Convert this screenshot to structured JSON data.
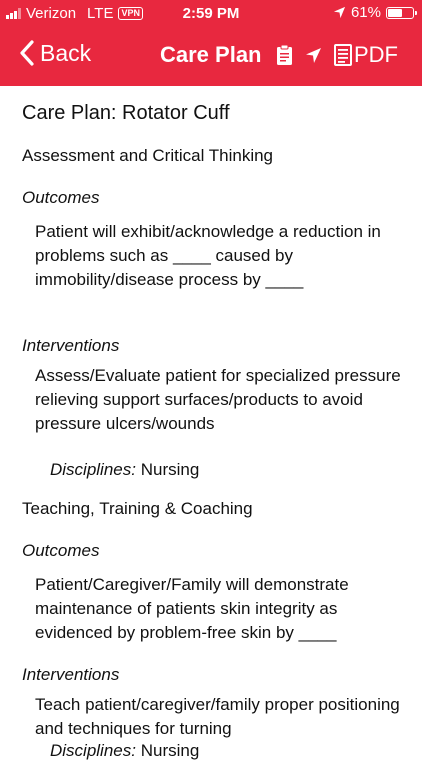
{
  "status_bar": {
    "carrier": "Verizon",
    "network": "LTE",
    "vpn": "VPN",
    "time": "2:59 PM",
    "battery": "61%",
    "battery_level": 0.61
  },
  "nav": {
    "back_label": "Back",
    "title": "Care Plan",
    "pdf_label": "PDF"
  },
  "document": {
    "title": "Care Plan: Rotator Cuff",
    "sections": [
      {
        "heading": "Assessment and Critical Thinking",
        "outcomes_label": "Outcomes",
        "outcome": "Patient will exhibit/acknowledge a reduction in problems such as ____ caused by immobility/disease process by ____",
        "interventions_label": "Interventions",
        "intervention": "Assess/Evaluate patient for specialized pressure relieving support surfaces/products to avoid pressure ulcers/wounds",
        "disciplines_label": "Disciplines:",
        "disciplines": "Nursing"
      },
      {
        "heading": "Teaching, Training & Coaching",
        "outcomes_label": "Outcomes",
        "outcome": "Patient/Caregiver/Family will demonstrate maintenance of patients skin integrity as evidenced by problem-free skin by ____",
        "interventions_label": "Interventions",
        "intervention": "Teach patient/caregiver/family proper positioning and techniques for turning",
        "disciplines_label": "Disciplines:",
        "disciplines": "Nursing"
      }
    ]
  },
  "colors": {
    "header_red": "#e8283f"
  }
}
